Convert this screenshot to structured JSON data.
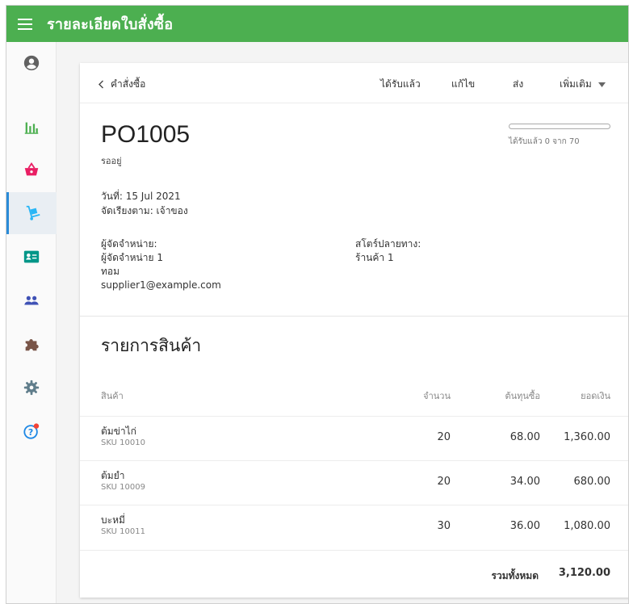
{
  "app": {
    "title": "รายละเอียดใบสั่งซื้อ"
  },
  "sidebar": {
    "items": [
      {
        "icon": "account-icon",
        "color": "#616161"
      },
      {
        "icon": "bar-chart-icon",
        "color": "#4caf50"
      },
      {
        "icon": "basket-icon",
        "color": "#e91e63"
      },
      {
        "icon": "dolly-icon",
        "color": "#29b6f6",
        "active": true
      },
      {
        "icon": "id-card-icon",
        "color": "#009688"
      },
      {
        "icon": "people-icon",
        "color": "#3f51b5"
      },
      {
        "icon": "puzzle-icon",
        "color": "#795548"
      },
      {
        "icon": "gear-icon",
        "color": "#607d8b"
      },
      {
        "icon": "help-icon",
        "color": "#1e88e5",
        "badge_color": "#f44336"
      }
    ]
  },
  "toolbar": {
    "back_label": "คำสั่งซื้อ",
    "received_label": "ได้รับแล้ว",
    "edit_label": "แก้ไข",
    "send_label": "ส่ง",
    "more_label": "เพิ่มเติม"
  },
  "po": {
    "number": "PO1005",
    "status": "รออยู่",
    "progress_text": "ได้รับแล้ว 0 จาก 70",
    "received": 0,
    "total_qty": 70,
    "date_line": "วันที่: 15 Jul 2021",
    "sort_line": "จัดเรียงตาม:  เจ้าของ"
  },
  "supplier": {
    "heading": "ผู้จัดจำหน่าย:",
    "name": "ผู้จัดจำหน่าย 1",
    "contact": "ทอม",
    "email": "supplier1@example.com"
  },
  "destination": {
    "heading": "สโตร์ปลายทาง:",
    "store": "ร้านค้า 1"
  },
  "items_section": {
    "title": "รายการสินค้า",
    "columns": {
      "product": "สินค้า",
      "quantity": "จำนวน",
      "cost": "ต้นทุนซื้อ",
      "amount": "ยอดเงิน"
    },
    "rows": [
      {
        "name": "ต้มข่าไก่",
        "sku": "SKU 10010",
        "quantity": "20",
        "cost": "68.00",
        "amount": "1,360.00"
      },
      {
        "name": "ต้มยำ",
        "sku": "SKU 10009",
        "quantity": "20",
        "cost": "34.00",
        "amount": "680.00"
      },
      {
        "name": "บะหมี่",
        "sku": "SKU 10011",
        "quantity": "30",
        "cost": "36.00",
        "amount": "1,080.00"
      }
    ],
    "total_label": "รวมทั้งหมด",
    "total_value": "3,120.00"
  }
}
